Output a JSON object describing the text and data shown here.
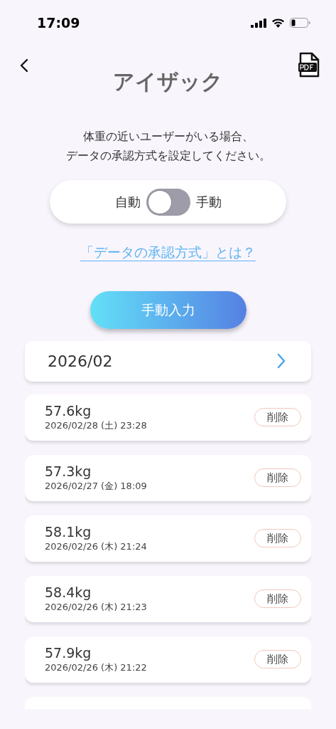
{
  "status_bar": {
    "time": "17:09"
  },
  "header": {
    "title": "アイザック"
  },
  "description": [
    "体重の近いユーザーがいる場合、",
    "データの承認方式を設定してください。"
  ],
  "approval_switch": {
    "left_label": "自動",
    "right_label": "手動",
    "on": false
  },
  "help_link": "「データの承認方式」とは？",
  "manual_button": "手動入力",
  "month": "2026/02",
  "records": [
    {
      "weight": "57.6kg",
      "datetime": "2026/02/28 (土) 23:28",
      "delete": "削除"
    },
    {
      "weight": "57.3kg",
      "datetime": "2026/02/27 (金) 18:09",
      "delete": "削除"
    },
    {
      "weight": "58.1kg",
      "datetime": "2026/02/26 (木) 21:24",
      "delete": "削除"
    },
    {
      "weight": "58.4kg",
      "datetime": "2026/02/26 (木) 21:23",
      "delete": "削除"
    },
    {
      "weight": "57.9kg",
      "datetime": "2026/02/26 (木) 21:22",
      "delete": "削除"
    }
  ]
}
